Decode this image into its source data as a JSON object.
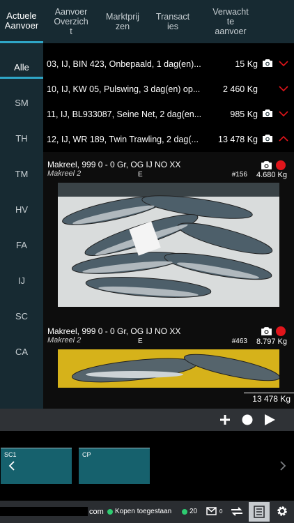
{
  "tabs": [
    {
      "label": "Actuele\nAanvoer",
      "active": true
    },
    {
      "label": "Aanvoer\nOverzich\nt"
    },
    {
      "label": "Marktprij\nzen"
    },
    {
      "label": "Transact\nies"
    },
    {
      "label": "Verwacht\nte\naanvoer"
    }
  ],
  "sidebar": [
    "Alle",
    "SM",
    "TH",
    "TM",
    "HV",
    "FA",
    "IJ",
    "SC",
    "CA"
  ],
  "rows": [
    {
      "desc": "03, IJ, BIN 423, Onbepaald, 1 dag(en)...",
      "weight": "15 Kg",
      "camera": true,
      "expanded": false
    },
    {
      "desc": "10, IJ, KW 05, Pulswing, 3 dag(en) op...",
      "weight": "2 460 Kg",
      "camera": false,
      "expanded": false
    },
    {
      "desc": "11, IJ, BL933087, Seine Net, 2 dag(en...",
      "weight": "985 Kg",
      "camera": true,
      "expanded": false
    },
    {
      "desc": "12, IJ, WR 189, Twin Trawling, 2 dag(...",
      "weight": "13 478 Kg",
      "camera": true,
      "expanded": true
    }
  ],
  "cards": [
    {
      "title": "Makreel, 999 0 - 0 Gr, OG IJ NO XX",
      "sub": "Makreel 2",
      "e": "E",
      "num": "#156",
      "kg": "4.680 Kg"
    },
    {
      "title": "Makreel, 999 0 - 0 Gr, OG IJ NO XX",
      "sub": "Makreel 2",
      "e": "E",
      "num": "#463",
      "kg": "8.797 Kg"
    }
  ],
  "total": "13 478 Kg",
  "stations": [
    "SC1",
    "CP"
  ],
  "status": {
    "domain_suffix": "com",
    "kopen": "Kopen toegestaan",
    "count": "20",
    "mail_count": "0"
  },
  "colors": {
    "accent": "#2fa6c7",
    "alert": "#e0151b",
    "online": "#2ecc71",
    "station": "#16616d"
  }
}
